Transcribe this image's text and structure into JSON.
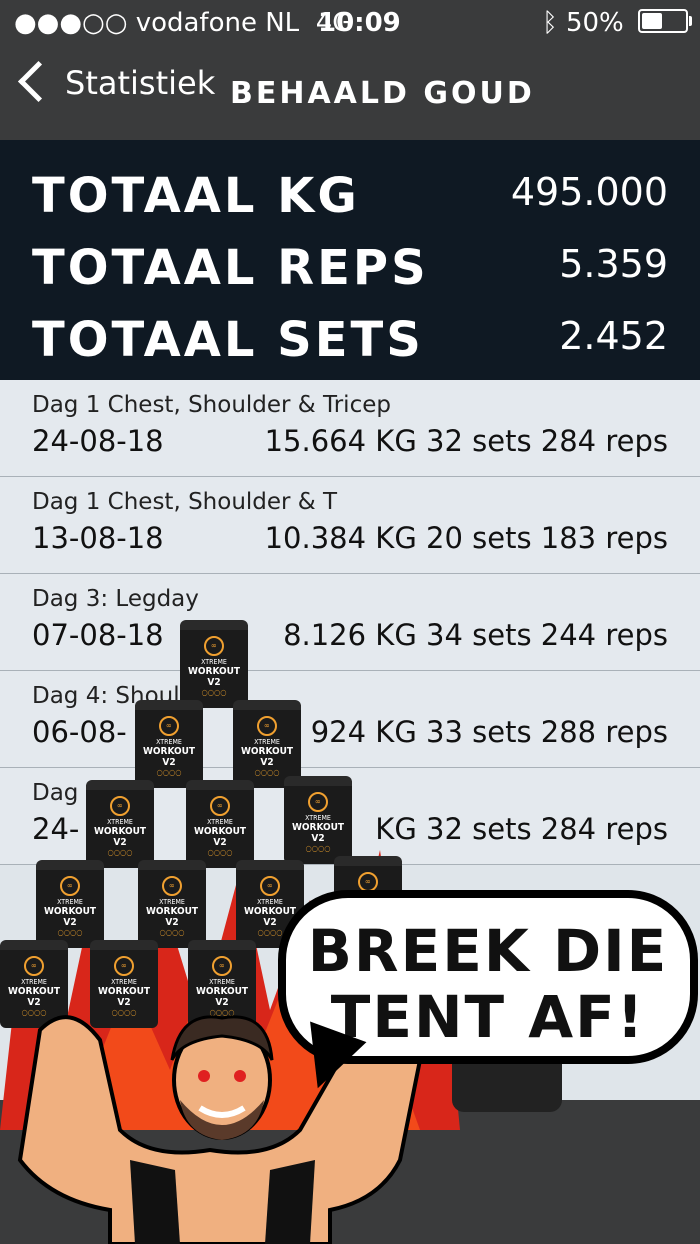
{
  "status": {
    "carrier": "vodafone NL",
    "network": "4G",
    "time": "10:09",
    "battery": "50%",
    "signal_icon": "signal-dots-icon",
    "bluetooth_icon": "bluetooth-icon"
  },
  "nav": {
    "back_label": "Statistiek",
    "title": "BEHAALD GOUD"
  },
  "totals": [
    {
      "label": "TOTAAL KG",
      "value": "495.000"
    },
    {
      "label": "TOTAAL REPS",
      "value": "5.359"
    },
    {
      "label": "TOTAAL SETS",
      "value": "2.452"
    }
  ],
  "workouts": [
    {
      "name": "Dag 1 Chest, Shoulder & Tricep",
      "date": "24-08-18",
      "stats": "15.664 KG 32 sets 284 reps"
    },
    {
      "name": "Dag 1 Chest, Shoulder & T",
      "date": "13-08-18",
      "stats": "10.384 KG 20 sets 183 reps"
    },
    {
      "name": "Dag 3: Legday",
      "date": "07-08-18",
      "stats": "8.126 KG 34 sets 244 reps"
    },
    {
      "name": "Dag 4: Shoul",
      "date": "06-08-",
      "stats": "924 KG 33 sets 288 reps"
    },
    {
      "name": "Dag",
      "date": "24-",
      "stats": "KG 32 sets 284 reps"
    }
  ],
  "overlay": {
    "bubble_text_line1": "BREEK DIE",
    "bubble_text_line2": "TENT AF!",
    "tub_line1": "XTREME",
    "tub_line2": "WORKOUT V2"
  },
  "colors": {
    "bar": "#3a3b3c",
    "totals_bg": "#0f1923",
    "list_bg": "#e4e9ee",
    "flame": "#d8261a"
  }
}
